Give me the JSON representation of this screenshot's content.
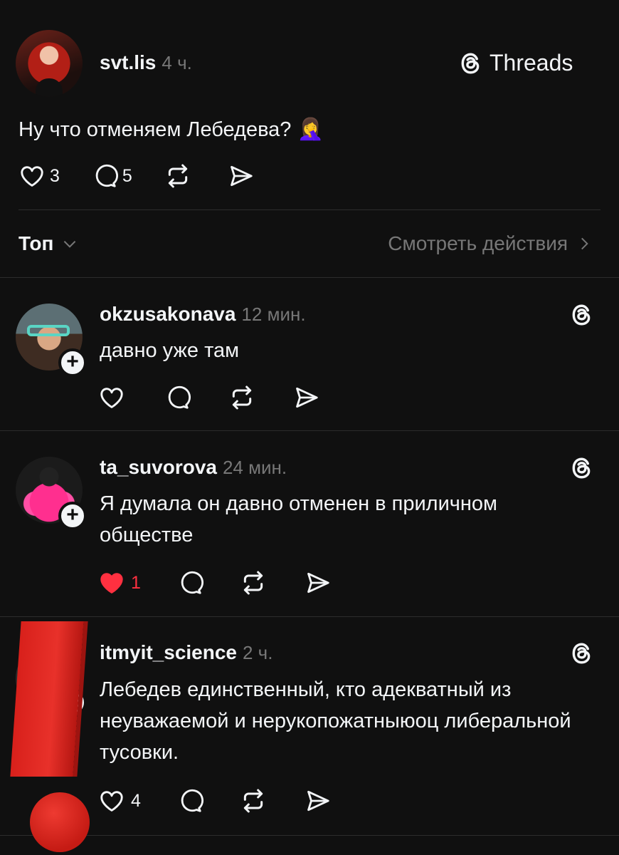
{
  "brand": {
    "name": "Threads"
  },
  "post": {
    "username": "svt.lis",
    "time": "4 ч.",
    "text": "Ну что отменяем Лебедева?",
    "emoji": "🤦‍♀️",
    "likes": "3",
    "replies": "5"
  },
  "filter": {
    "sort_label": "Топ",
    "activity_link": "Смотреть действия"
  },
  "comments": [
    {
      "username": "okzusakonava",
      "time": "12 мин.",
      "text": "давно уже там",
      "likes": "",
      "liked": false
    },
    {
      "username": "ta_suvorova",
      "time": "24 мин.",
      "text": "Я думала он давно отменен в приличном обществе",
      "likes": "1",
      "liked": true
    },
    {
      "username": "itmyit_science",
      "time": "2 ч.",
      "text": "Лебедев единственный, кто адекватный из неуважаемой и нерукопожатныюоц либеральной тусовки.",
      "likes": "4",
      "liked": false
    }
  ],
  "colors": {
    "background": "#101010",
    "text": "#f3f5f7",
    "muted": "#777777",
    "like_red": "#ff3040",
    "overlay_red": "#e0251e"
  }
}
